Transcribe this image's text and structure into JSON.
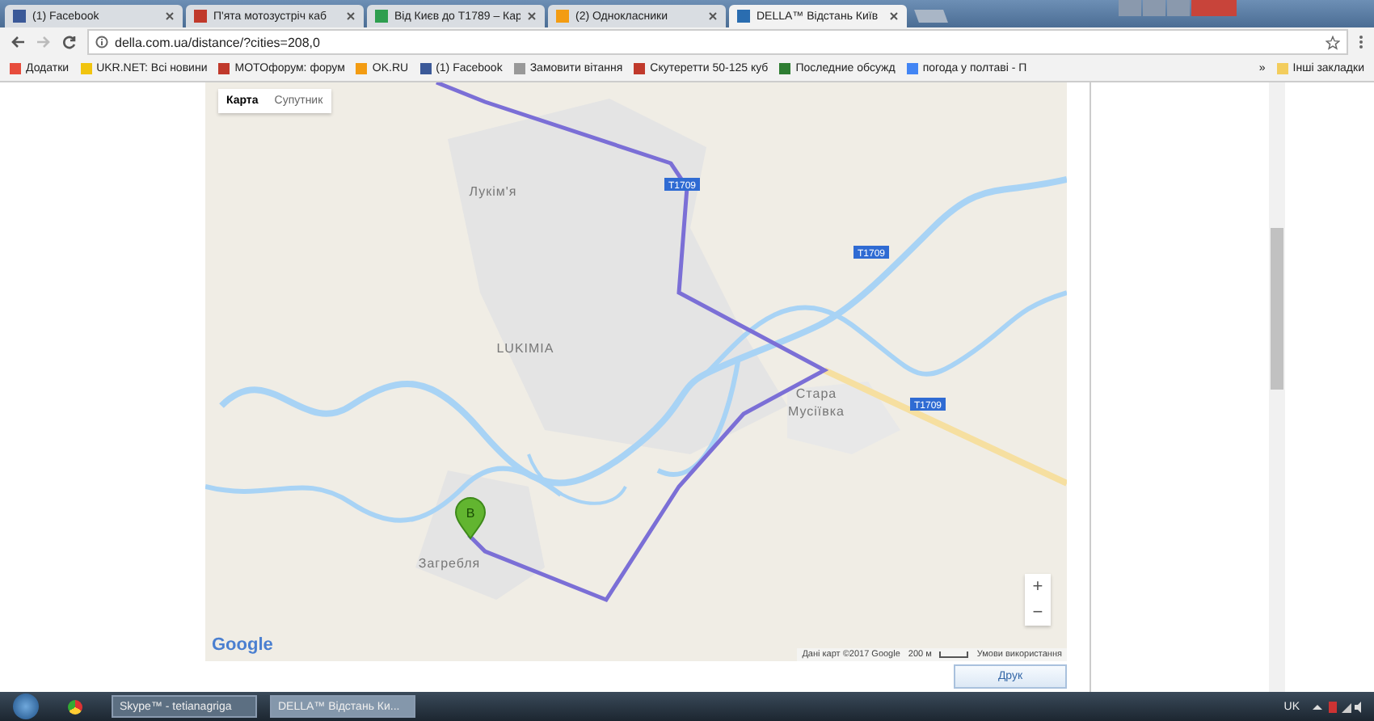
{
  "browser": {
    "tabs": [
      {
        "title": "(1) Facebook",
        "selected": false
      },
      {
        "title": "П'ята мотозустріч каб",
        "selected": false
      },
      {
        "title": "Від Києв до Т1789 – Кар",
        "selected": false
      },
      {
        "title": "(2) Однокласники",
        "selected": false
      },
      {
        "title": "DELLA™ Відстань Київ",
        "selected": true
      }
    ],
    "address": {
      "url": "della.com.ua/distance/?cities=208,0"
    },
    "bookmarks": [
      {
        "label": "Додатки"
      },
      {
        "label": "UKR.NET: Всі новини"
      },
      {
        "label": "MOTOфорум: форум"
      },
      {
        "label": "OK.RU"
      },
      {
        "label": "(1) Facebook"
      },
      {
        "label": "Замовити вітання"
      },
      {
        "label": "Скутеретти 50-125 куб"
      },
      {
        "label": "Последние обсужд"
      },
      {
        "label": "погода у полтаві - П"
      }
    ],
    "more_bookmarks": "»",
    "other_bookmarks": "Інші закладки"
  },
  "map": {
    "type_buttons": [
      {
        "label": "Карта",
        "selected": true
      },
      {
        "label": "Супутник",
        "selected": false
      }
    ],
    "places": [
      "Лукім'я",
      "LUKIMIA",
      "Стара",
      "Мусіївка",
      "Загребля"
    ],
    "road_badges": [
      "Т1709",
      "Т1709",
      "Т1709"
    ],
    "marker": "B",
    "zoom_in": "+",
    "zoom_out": "−",
    "attribution": "Дані карт ©2017 Google",
    "scale": "200 м",
    "terms": "Умови використання",
    "logo": "Google"
  },
  "print_button": "Друк",
  "taskbar": {
    "windows": [
      {
        "title": "Skype™ - tetianagriga",
        "selected": false
      },
      {
        "title": "DELLA™ Відстань Ки...",
        "selected": true
      }
    ],
    "language": "UK"
  }
}
